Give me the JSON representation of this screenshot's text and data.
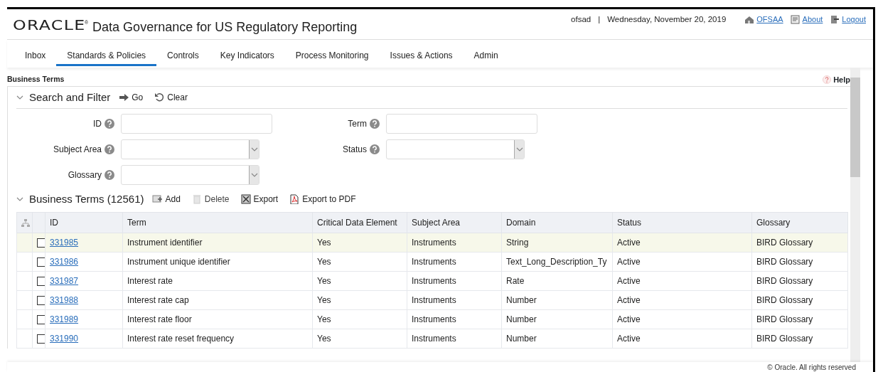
{
  "header": {
    "logo": "ORACLE",
    "trademark": "®",
    "title": "Data Governance for US Regulatory Reporting",
    "user": "ofsad",
    "separator": "|",
    "date": "Wednesday, November 20, 2019",
    "links": [
      {
        "label": "OFSAA",
        "kind": "home"
      },
      {
        "label": "About",
        "kind": "about"
      },
      {
        "label": "Logout",
        "kind": "logout"
      }
    ]
  },
  "tabs": [
    {
      "label": "Inbox",
      "selected": false
    },
    {
      "label": "Standards & Policies",
      "selected": true
    },
    {
      "label": "Controls",
      "selected": false
    },
    {
      "label": "Key Indicators",
      "selected": false
    },
    {
      "label": "Process Monitoring",
      "selected": false
    },
    {
      "label": "Issues & Actions",
      "selected": false
    },
    {
      "label": "Admin",
      "selected": false
    }
  ],
  "panel": {
    "title": "Business Terms",
    "help": "Help"
  },
  "search": {
    "title": "Search and Filter",
    "expanded": true,
    "actions": [
      {
        "label": "Go",
        "kind": "go"
      },
      {
        "label": "Clear",
        "kind": "clear"
      }
    ],
    "fields": [
      {
        "label": "ID",
        "kind": "text"
      },
      {
        "label": "Term",
        "kind": "text"
      },
      {
        "label": "Subject Area",
        "kind": "select"
      },
      {
        "label": "Status",
        "kind": "select"
      },
      {
        "label": "Glossary",
        "kind": "select"
      }
    ]
  },
  "list": {
    "title": "Business Terms (12561)",
    "expanded": true,
    "actions": [
      {
        "label": "Add",
        "kind": "add",
        "disabled": false
      },
      {
        "label": "Delete",
        "kind": "delete",
        "disabled": true
      },
      {
        "label": "Export",
        "kind": "export",
        "disabled": false
      },
      {
        "label": "Export to PDF",
        "kind": "pdf",
        "disabled": false
      }
    ],
    "columns": [
      "ID",
      "Term",
      "Critical Data Element",
      "Subject Area",
      "Domain",
      "Status",
      "Glossary"
    ],
    "rows": [
      {
        "checked": false,
        "highlighted": true,
        "cells": [
          "331985",
          "Instrument identifier",
          "Yes",
          "Instruments",
          "String",
          "Active",
          "BIRD Glossary"
        ]
      },
      {
        "checked": false,
        "highlighted": false,
        "cells": [
          "331986",
          "Instrument unique identifier",
          "Yes",
          "Instruments",
          "Text_Long_Description_Ty",
          "Active",
          "BIRD Glossary"
        ]
      },
      {
        "checked": false,
        "highlighted": false,
        "cells": [
          "331987",
          "Interest rate",
          "Yes",
          "Instruments",
          "Rate",
          "Active",
          "BIRD Glossary"
        ]
      },
      {
        "checked": false,
        "highlighted": false,
        "cells": [
          "331988",
          "Interest rate cap",
          "Yes",
          "Instruments",
          "Number",
          "Active",
          "BIRD Glossary"
        ]
      },
      {
        "checked": false,
        "highlighted": false,
        "cells": [
          "331989",
          "Interest rate floor",
          "Yes",
          "Instruments",
          "Number",
          "Active",
          "BIRD Glossary"
        ]
      },
      {
        "checked": false,
        "highlighted": false,
        "cells": [
          "331990",
          "Interest rate reset frequency",
          "Yes",
          "Instruments",
          "Number",
          "Active",
          "BIRD Glossary"
        ]
      }
    ]
  },
  "footer": "© Oracle. All rights reserved"
}
